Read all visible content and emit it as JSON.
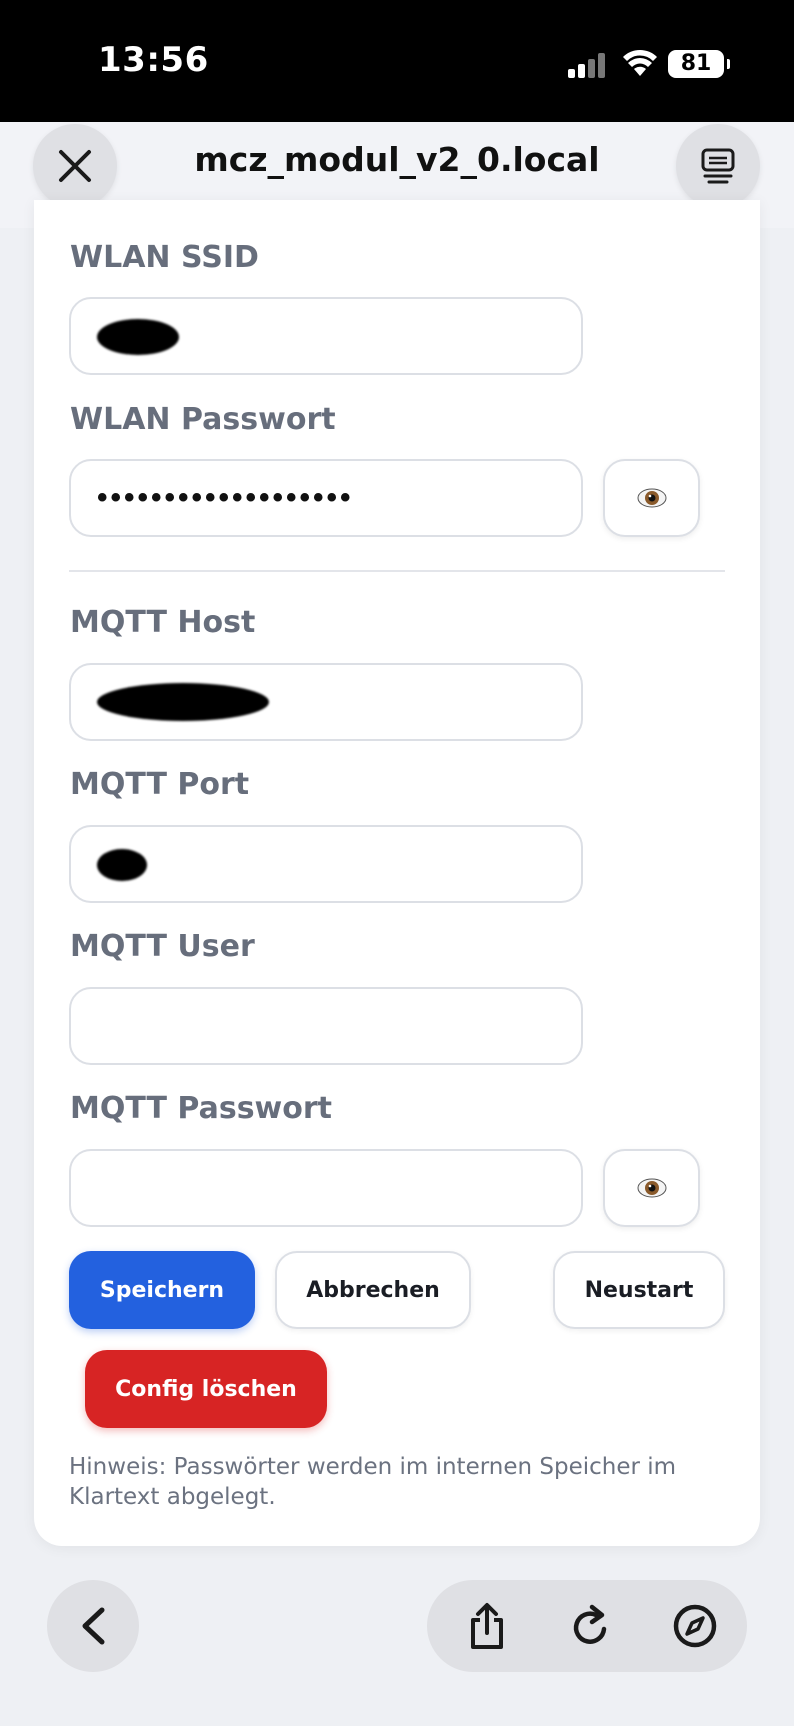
{
  "status_bar": {
    "time": "13:56",
    "battery": "81"
  },
  "browser": {
    "url": "mcz_modul_v2_0.local"
  },
  "form": {
    "wlan_ssid": {
      "label": "WLAN SSID",
      "value": ""
    },
    "wlan_password": {
      "label": "WLAN Passwort",
      "value": "•••••••••••••••••••"
    },
    "mqtt_host": {
      "label": "MQTT Host",
      "value": ""
    },
    "mqtt_port": {
      "label": "MQTT Port",
      "value": ""
    },
    "mqtt_user": {
      "label": "MQTT User",
      "value": ""
    },
    "mqtt_password": {
      "label": "MQTT Passwort",
      "value": ""
    }
  },
  "buttons": {
    "save": "Speichern",
    "cancel": "Abbrechen",
    "restart": "Neustart",
    "delete_config": "Config löschen"
  },
  "hint": "Hinweis: Passwörter werden im internen Speicher im Klartext abgelegt.",
  "icons": {
    "close": "close-icon",
    "menu": "reader-icon",
    "eye": "eye-icon",
    "back": "chevron-left-icon",
    "share": "share-icon",
    "reload": "reload-icon",
    "compass": "compass-icon"
  },
  "colors": {
    "primary": "#2361df",
    "danger": "#d72424",
    "label": "#676e7c"
  }
}
